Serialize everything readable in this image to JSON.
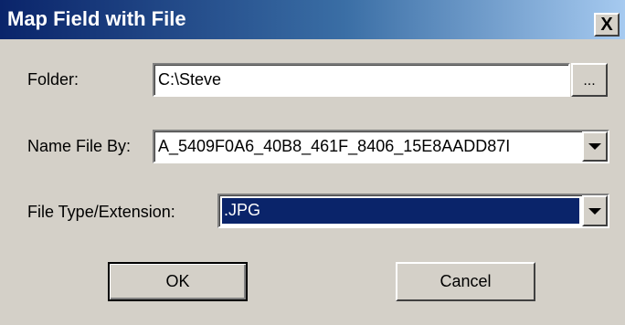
{
  "window": {
    "title": "Map Field with File",
    "close_label": "X"
  },
  "folder": {
    "label": "Folder:",
    "value": "C:\\Steve",
    "browse_label": "..."
  },
  "name_file_by": {
    "label": "Name File By:",
    "value": "A_5409F0A6_40B8_461F_8406_15E8AADD87I"
  },
  "file_type": {
    "label": "File Type/Extension:",
    "value": ".JPG"
  },
  "buttons": {
    "ok": "OK",
    "cancel": "Cancel"
  },
  "colors": {
    "title_start": "#0a246a",
    "title_end": "#a6caf0",
    "selection": "#0a246a",
    "face": "#d4d0c8"
  }
}
